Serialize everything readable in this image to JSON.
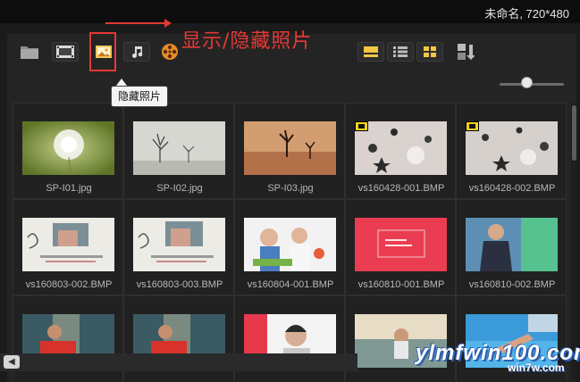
{
  "window": {
    "project_title": "未命名, 720*480"
  },
  "annotation": {
    "text": "显示/隐藏照片",
    "color": "#e53935"
  },
  "tooltip": {
    "text": "隐藏照片"
  },
  "toolbar": {
    "buttons": [
      {
        "icon": "folder-icon",
        "tooltip": ""
      },
      {
        "icon": "film-icon"
      },
      {
        "icon": "photo-icon"
      },
      {
        "icon": "music-note-icon"
      },
      {
        "icon": "film-reel-icon"
      },
      {
        "icon": "thumbnail-view-icon"
      },
      {
        "icon": "list-view-icon"
      },
      {
        "icon": "grid-view-icon"
      },
      {
        "icon": "sort-az-icon"
      }
    ],
    "zoom_slider_level": 0.4
  },
  "media": {
    "items": [
      {
        "label": "SP-I01.jpg",
        "badge": false
      },
      {
        "label": "SP-I02.jpg",
        "badge": false
      },
      {
        "label": "SP-I03.jpg",
        "badge": false
      },
      {
        "label": "vs160428-001.BMP",
        "badge": true
      },
      {
        "label": "vs160428-002.BMP",
        "badge": true
      },
      {
        "label": "vs160803-002.BMP",
        "badge": false
      },
      {
        "label": "vs160803-003.BMP",
        "badge": false
      },
      {
        "label": "vs160804-001.BMP",
        "badge": false
      },
      {
        "label": "vs160810-001.BMP",
        "badge": false
      },
      {
        "label": "vs160810-002.BMP",
        "badge": false
      },
      {
        "label": "",
        "badge": false
      },
      {
        "label": "",
        "badge": false
      },
      {
        "label": "",
        "badge": false
      },
      {
        "label": "",
        "badge": false
      },
      {
        "label": "",
        "badge": false
      }
    ]
  },
  "watermark": {
    "text": "ylmfwin100.com",
    "sub": "win7w.com"
  }
}
